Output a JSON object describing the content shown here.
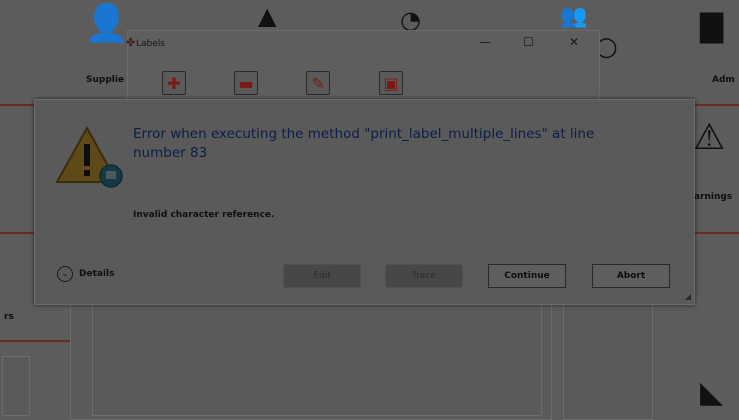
{
  "background": {
    "supplier_label": "Supplie",
    "admin_label": "Adm",
    "warnings_label": "arnings",
    "left_fragment_label": "rs"
  },
  "labels_window": {
    "title": "Labels",
    "minimize": "—",
    "maximize": "☐",
    "close": "✕",
    "toolbar": [
      {
        "icon": "add-icon",
        "glyph": "✚"
      },
      {
        "icon": "remove-icon",
        "glyph": "▬"
      },
      {
        "icon": "edit-icon",
        "glyph": "✎"
      },
      {
        "icon": "print-icon",
        "glyph": "▣"
      }
    ]
  },
  "dialog": {
    "message": "Error when executing the method \"print_label_multiple_lines\" at line number 83",
    "detail": "Invalid character reference.",
    "details_toggle": "Details",
    "buttons": {
      "edit": "Edit",
      "trace": "Trace",
      "continue": "Continue",
      "abort": "Abort"
    }
  }
}
